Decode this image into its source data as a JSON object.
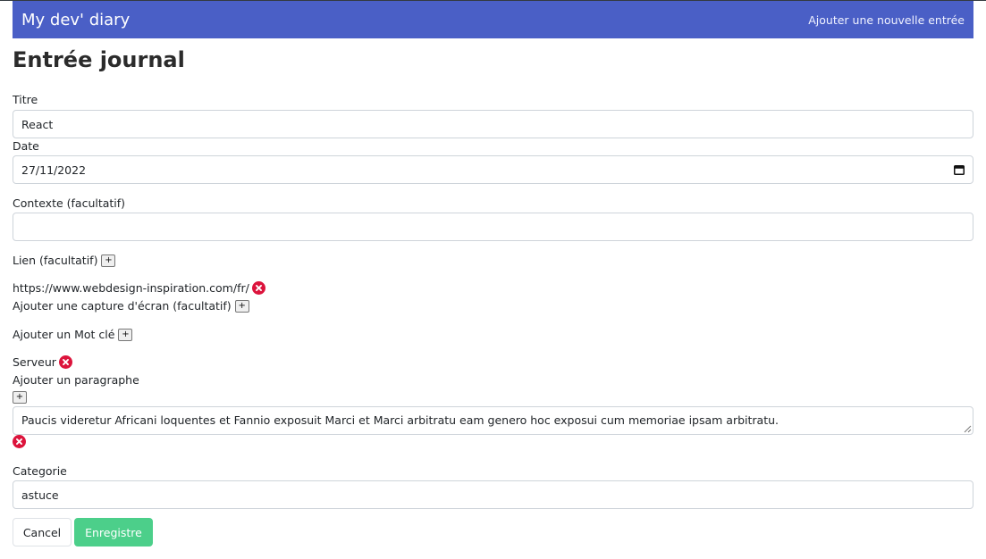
{
  "navbar": {
    "brand": "My dev' diary",
    "add_entry_link": "Ajouter une nouvelle entrée",
    "background_color": "#4a5fc6"
  },
  "page_title": "Entrée journal",
  "form": {
    "title": {
      "label": "Titre",
      "value": "React"
    },
    "date": {
      "label": "Date",
      "value": "27/11/2022",
      "icon": "calendar-icon"
    },
    "context": {
      "label": "Contexte (facultatif)",
      "value": ""
    },
    "link": {
      "label": "Lien (facultatif)",
      "add_button": "+",
      "items": [
        "https://www.webdesign-inspiration.com/fr/"
      ]
    },
    "screenshot": {
      "label": "Ajouter une capture d'écran (facultatif)",
      "add_button": "+"
    },
    "keyword": {
      "label": "Ajouter un Mot clé",
      "add_button": "+",
      "items": [
        "Serveur"
      ]
    },
    "paragraph": {
      "label": "Ajouter un paragraphe",
      "add_button": "+",
      "items": [
        "Paucis videretur Africani loquentes et Fannio exposuit Marci et Marci arbitratu eam genero hoc exposui cum memoriae ipsam arbitratu."
      ]
    },
    "category": {
      "label": "Categorie",
      "value": "astuce"
    },
    "cancel_button": "Cancel",
    "save_button": "Enregistre",
    "remove_icon": "close-circle-icon",
    "remove_color": "#dc143c",
    "save_color": "#4ccf8a"
  }
}
